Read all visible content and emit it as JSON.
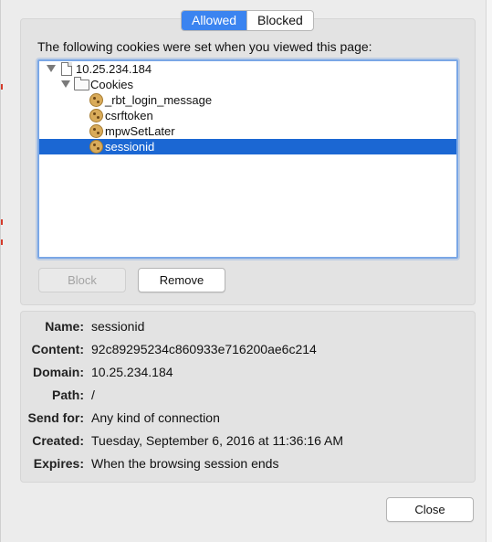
{
  "segments": {
    "allowed": "Allowed",
    "blocked": "Blocked",
    "active": "Allowed",
    "active_color": "#3b84f0"
  },
  "intro_text": "The following cookies were set when you viewed this page:",
  "tree": {
    "site": {
      "label": "10.25.234.184",
      "icon": "document-icon",
      "expanded": true
    },
    "folder": {
      "label": "Cookies",
      "icon": "folder-icon",
      "expanded": true
    },
    "cookies": [
      {
        "label": "_rbt_login_message",
        "icon": "cookie-icon",
        "selected": false
      },
      {
        "label": "csrftoken",
        "icon": "cookie-icon",
        "selected": false
      },
      {
        "label": "mpwSetLater",
        "icon": "cookie-icon",
        "selected": false
      },
      {
        "label": "sessionid",
        "icon": "cookie-icon",
        "selected": true
      }
    ],
    "selection_color": "#1b67d3"
  },
  "buttons": {
    "block": "Block",
    "block_enabled": false,
    "remove": "Remove",
    "close": "Close"
  },
  "details": {
    "name_label": "Name:",
    "name": "sessionid",
    "content_label": "Content:",
    "content": "92c89295234c860933e716200ae6c214",
    "domain_label": "Domain:",
    "domain": "10.25.234.184",
    "path_label": "Path:",
    "path": "/",
    "send_for_label": "Send for:",
    "send_for": "Any kind of connection",
    "created_label": "Created:",
    "created": "Tuesday, September 6, 2016 at 11:36:16 AM",
    "expires_label": "Expires:",
    "expires": "When the browsing session ends"
  }
}
